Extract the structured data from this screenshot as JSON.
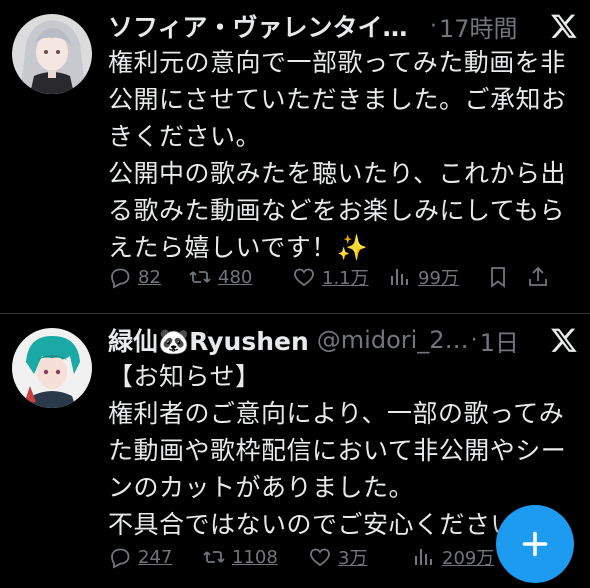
{
  "tweets": [
    {
      "name": "ソフィア・ヴァレンタイン…",
      "handle": "",
      "time": "17時間",
      "lines": [
        "権利元の意向で一部歌ってみた動画を非",
        "公開にさせていただきました。ご承知お",
        "きください。",
        "公開中の歌みたを聴いたり、これから出",
        "る歌みた動画などをお楽しみにしてもら",
        "えたら嬉しいです！✨"
      ],
      "replies": "82",
      "reposts": "480",
      "likes": "1.1万",
      "views": "99万"
    },
    {
      "name": "緑仙🐼Ryushen",
      "handle": "@midori_2…",
      "time": "1日",
      "lines": [
        "【お知らせ】",
        "権利者のご意向により、一部の歌ってみ",
        "た動画や歌枠配信において非公開やシー",
        "ンのカットがありました。",
        "不具合ではないのでご安心ください。"
      ],
      "replies": "247",
      "reposts": "1108",
      "likes": "3万",
      "views": "209万"
    }
  ],
  "colors": {
    "background": "#000000",
    "text": "#e7e9ea",
    "muted": "#71767b",
    "accent": "#1d9bf0",
    "divider": "#2f3336"
  },
  "icons": [
    "x-logo-icon",
    "reply-icon",
    "repost-icon",
    "like-icon",
    "views-icon",
    "bookmark-icon",
    "share-icon",
    "plus-icon"
  ]
}
